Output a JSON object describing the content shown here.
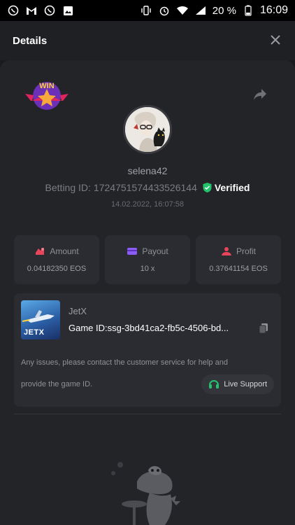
{
  "statusbar": {
    "battery": "20 %",
    "time": "16:09",
    "left_icons": [
      "viber-icon",
      "gmail-icon",
      "viber-icon",
      "gallery-icon"
    ],
    "right_icons": [
      "vibrate-icon",
      "alarm-icon",
      "wifi-icon",
      "signal-icon",
      "battery-icon"
    ]
  },
  "header": {
    "title": "Details",
    "close_icon": "close-icon"
  },
  "bet": {
    "win_badge": "WIN",
    "username": "selena42",
    "betting_id_label": "Betting ID:",
    "betting_id": "1724751574433526144",
    "verified_label": "Verified",
    "timestamp": "14.02.2022, 16:07:58"
  },
  "stats": [
    {
      "label": "Amount",
      "value": "0.04182350 EOS",
      "icon": "amount-icon",
      "color": "#e8445a"
    },
    {
      "label": "Payout",
      "value": "10 x",
      "icon": "payout-icon",
      "color": "#8b5cf6"
    },
    {
      "label": "Profit",
      "value": "0.37641154 EOS",
      "icon": "profit-icon",
      "color": "#e8445a"
    }
  ],
  "game": {
    "name": "JetX",
    "thumb_label": "JETX",
    "id_text": "Game ID:ssg-3bd41ca2-fb5c-4506-bd...",
    "note_line1": "Any issues, please contact the customer service for help and",
    "note_line2": "provide the game ID.",
    "support_label": "Live Support"
  },
  "colors": {
    "accent_green": "#25c26e",
    "background": "#1a1b1e",
    "card": "#2b2c31"
  }
}
